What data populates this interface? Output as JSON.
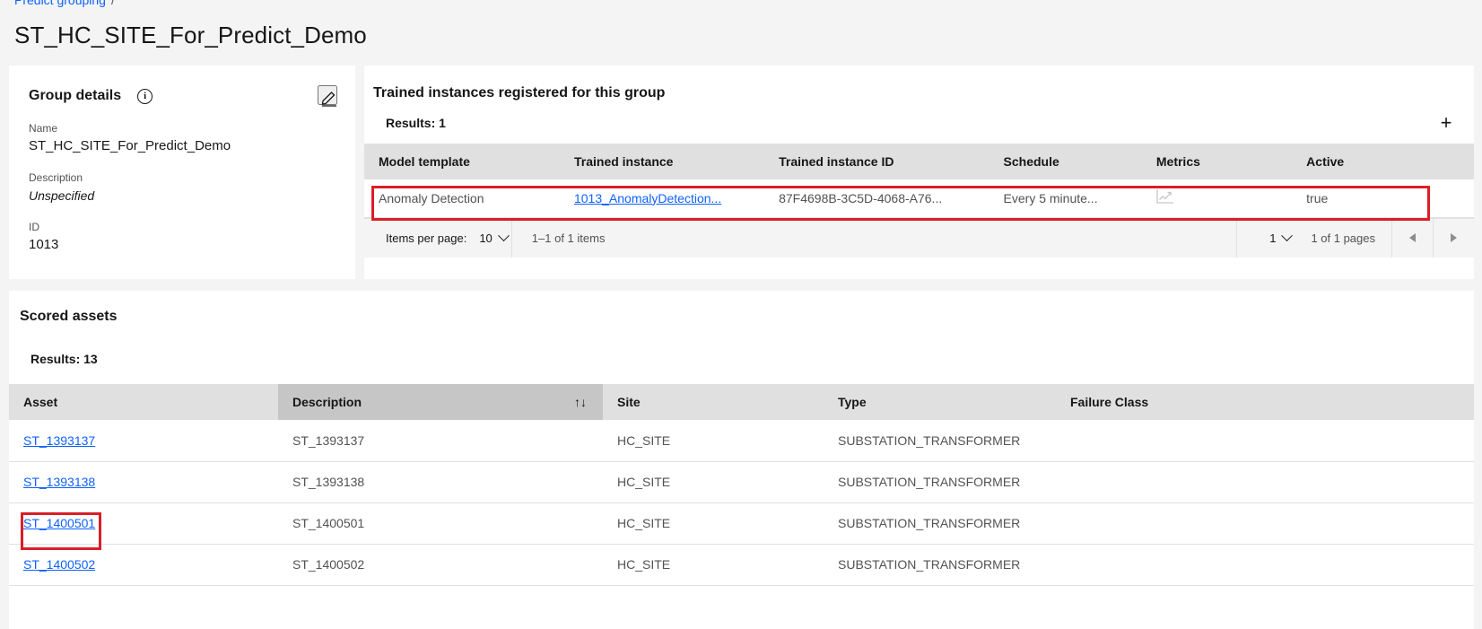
{
  "breadcrumb": {
    "parent": "Predict grouping",
    "separator": "/"
  },
  "page_title": "ST_HC_SITE_For_Predict_Demo",
  "group_details": {
    "heading": "Group details",
    "info_icon": "info-icon",
    "info_glyph": "i",
    "edit_icon": "edit-pencil-icon",
    "fields": [
      {
        "label": "Name",
        "value": "ST_HC_SITE_For_Predict_Demo"
      },
      {
        "label": "Description",
        "value": "Unspecified"
      },
      {
        "label": "ID",
        "value": "1013"
      }
    ]
  },
  "trained_instances": {
    "heading": "Trained instances registered for this group",
    "results": "Results: 1",
    "add_label": "+",
    "columns": [
      "Model template",
      "Trained instance",
      "Trained instance ID",
      "Schedule",
      "Metrics",
      "Active"
    ],
    "rows": [
      {
        "model_template": "Anomaly Detection",
        "trained_instance": "1013_AnomalyDetection...",
        "trained_instance_id": "87F4698B-3C5D-4068-A76...",
        "schedule": "Every 5 minute...",
        "metrics_icon": "line-chart-icon",
        "active": "true"
      }
    ],
    "pagination": {
      "items_per_page_label": "Items per page:",
      "items_per_page_value": "10",
      "range_text": "1–1 of 1 items",
      "page_value": "1",
      "pages_text": "1 of 1 pages",
      "prev_icon": "caret-left-icon",
      "next_icon": "caret-right-icon"
    }
  },
  "scored_assets": {
    "heading": "Scored assets",
    "results": "Results: 13",
    "columns": [
      "Asset",
      "Description",
      "Site",
      "Type",
      "Failure Class"
    ],
    "sort_icon": "↑↓",
    "rows": [
      {
        "asset": "ST_1393137",
        "description": "ST_1393137",
        "site": "HC_SITE",
        "type": "SUBSTATION_TRANSFORMER",
        "failure_class": ""
      },
      {
        "asset": "ST_1393138",
        "description": "ST_1393138",
        "site": "HC_SITE",
        "type": "SUBSTATION_TRANSFORMER",
        "failure_class": ""
      },
      {
        "asset": "ST_1400501",
        "description": "ST_1400501",
        "site": "HC_SITE",
        "type": "SUBSTATION_TRANSFORMER",
        "failure_class": ""
      },
      {
        "asset": "ST_1400502",
        "description": "ST_1400502",
        "site": "HC_SITE",
        "type": "SUBSTATION_TRANSFORMER",
        "failure_class": ""
      }
    ]
  },
  "annotations": {
    "color": "#da1e28",
    "row_highlight": "trained-instance-row",
    "link_highlight": "asset-link-st-1400501"
  }
}
